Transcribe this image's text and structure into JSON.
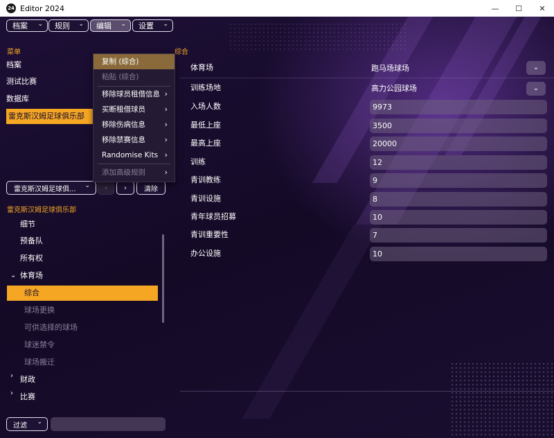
{
  "window": {
    "title": "Editor 2024",
    "icon_text": "24",
    "controls": [
      "—",
      "☐",
      "✕"
    ]
  },
  "menubar": {
    "items": [
      {
        "label": "档案"
      },
      {
        "label": "规则"
      },
      {
        "label": "编辑"
      },
      {
        "label": "设置"
      }
    ]
  },
  "edit_menu": {
    "items": [
      {
        "label": "复制 (综合)",
        "highlighted": true
      },
      {
        "label": "粘贴 (综合)",
        "disabled": true
      },
      {
        "label": "移除球员租借信息",
        "submenu": true
      },
      {
        "label": "买断租借球员",
        "submenu": true
      },
      {
        "label": "移除伤病信息",
        "submenu": true
      },
      {
        "label": "移除禁赛信息",
        "submenu": true
      },
      {
        "label": "Randomise Kits",
        "submenu": true
      },
      {
        "label": "添加高级规则",
        "submenu": true,
        "disabled": true
      }
    ]
  },
  "sidebar": {
    "title": "菜单",
    "items": [
      {
        "label": "档案"
      },
      {
        "label": "测试比赛"
      },
      {
        "label": "数据库"
      },
      {
        "label": "雷克斯汉姆足球俱乐部",
        "selected": true
      }
    ],
    "club_select": "雷克斯汉姆足球俱...",
    "prev_glyph": "‹",
    "next_glyph": "›",
    "clear_label": "清除",
    "tree_title": "雷克斯汉姆足球俱乐部",
    "tree": [
      {
        "label": "细节"
      },
      {
        "label": "预备队"
      },
      {
        "label": "所有权"
      },
      {
        "label": "体育场",
        "expanded": true
      },
      {
        "label": "综合",
        "selected": true
      },
      {
        "label": "球场更换",
        "dim": true
      },
      {
        "label": "可供选择的球场",
        "dim": true
      },
      {
        "label": "球迷禁令",
        "dim": true
      },
      {
        "label": "球场搬迁",
        "dim": true
      },
      {
        "label": "财政",
        "collapsed": true
      },
      {
        "label": "比赛",
        "collapsed": true
      }
    ],
    "filter_label": "过滤"
  },
  "main": {
    "section_title": "综合",
    "fields": [
      {
        "label": "体育场",
        "value": "跑马场球场",
        "type": "select"
      },
      {
        "label": "训练场地",
        "value": "高力公园球场",
        "type": "select"
      },
      {
        "label": "入场人数",
        "value": "9973"
      },
      {
        "label": "最低上座",
        "value": "3500"
      },
      {
        "label": "最高上座",
        "value": "20000"
      },
      {
        "label": "训练",
        "value": "12"
      },
      {
        "label": "青训教练",
        "value": "9"
      },
      {
        "label": "青训设施",
        "value": "8"
      },
      {
        "label": "青年球员招募",
        "value": "10"
      },
      {
        "label": "青训重要性",
        "value": "7"
      },
      {
        "label": "办公设施",
        "value": "10"
      }
    ]
  },
  "colors": {
    "accent": "#f5a623",
    "background": "#1a0d2e",
    "field": "#6e5f7d"
  }
}
